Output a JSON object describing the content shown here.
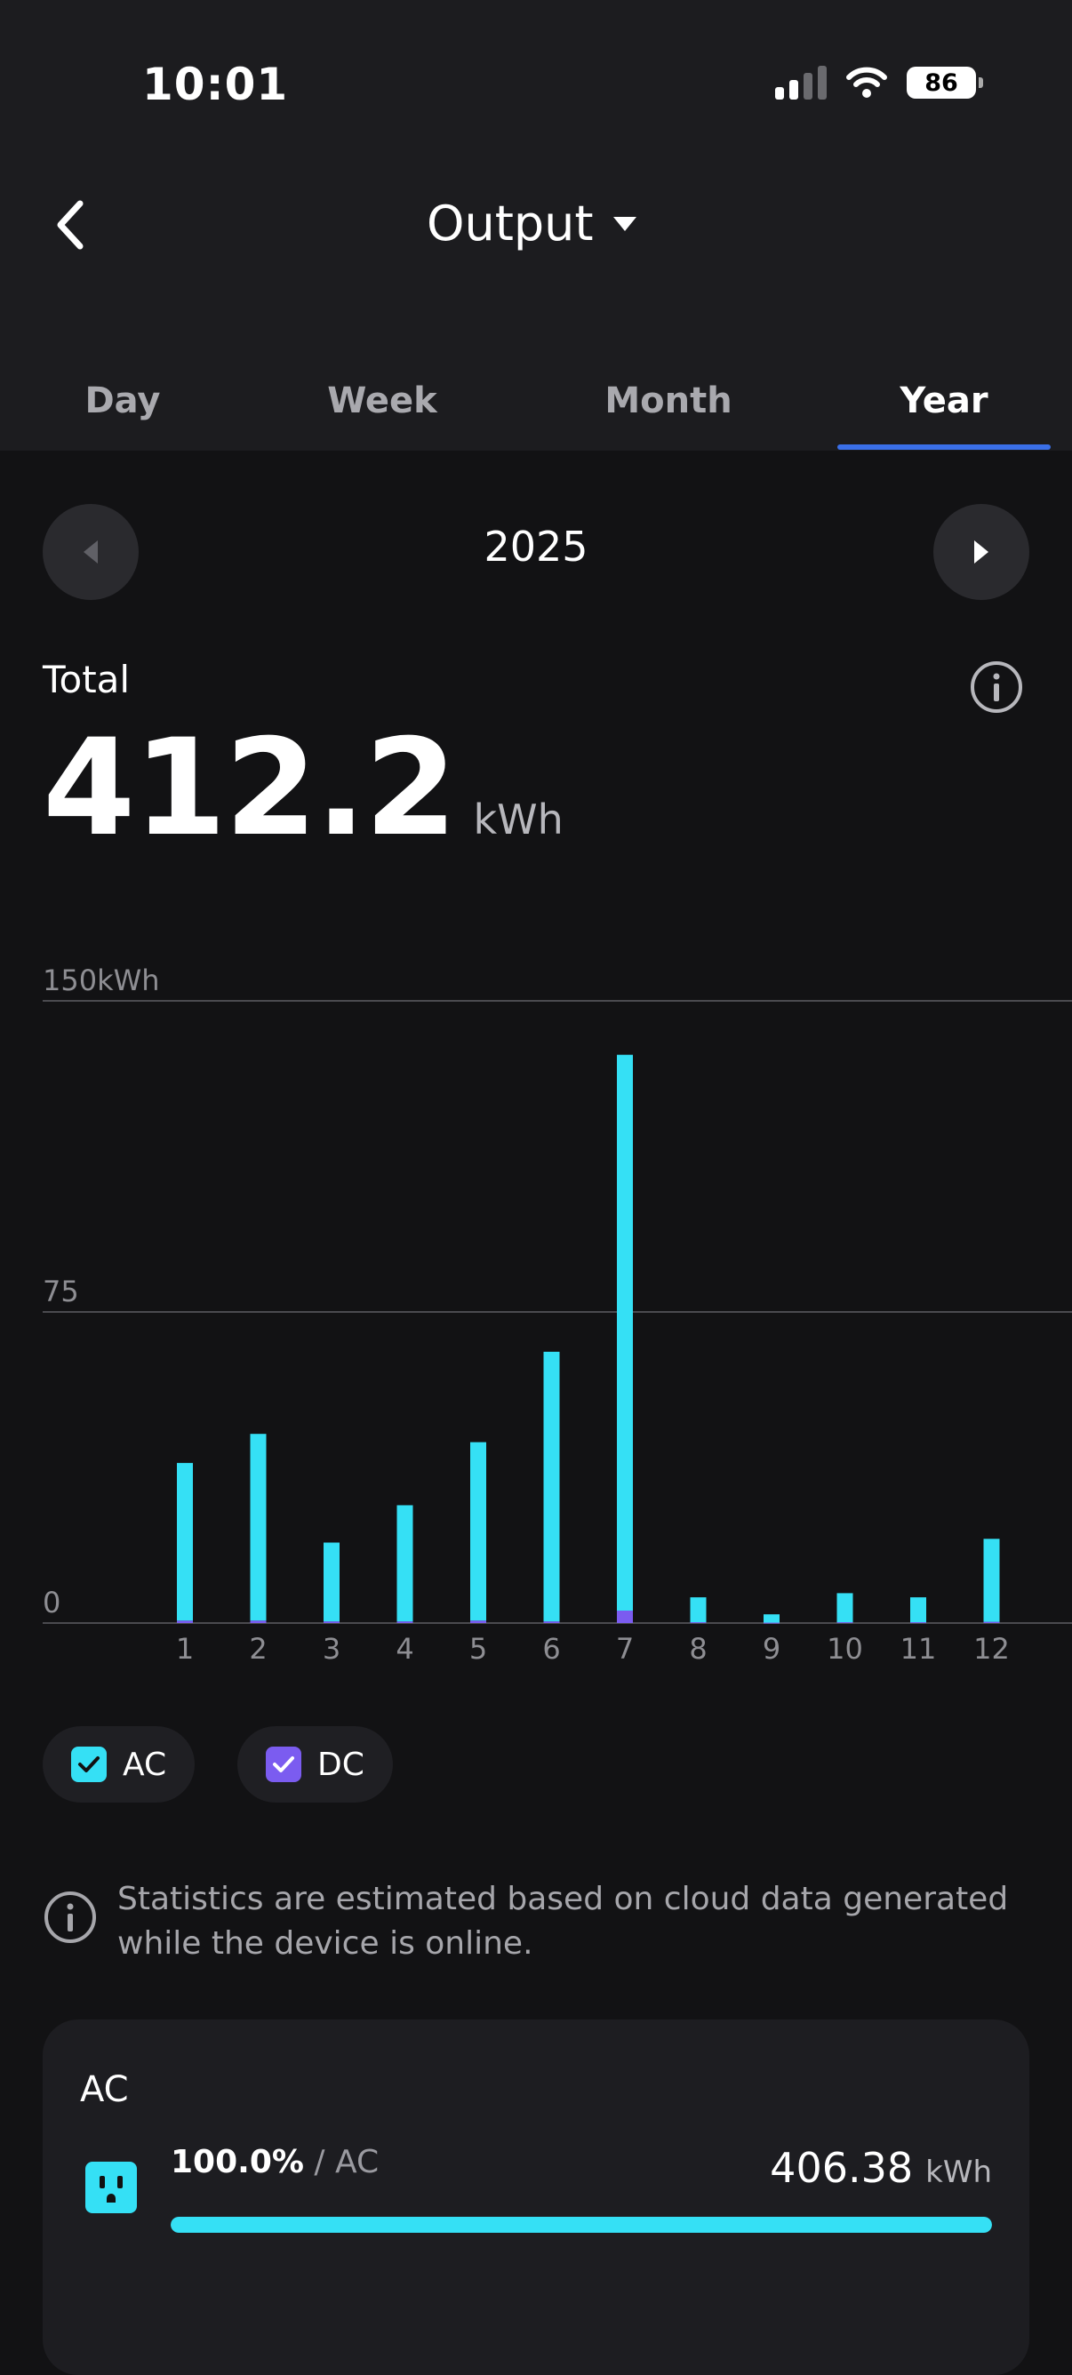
{
  "status_bar": {
    "time": "10:01",
    "battery": "86"
  },
  "header": {
    "title": "Output"
  },
  "tabs": [
    {
      "label": "Day",
      "active": false
    },
    {
      "label": "Week",
      "active": false
    },
    {
      "label": "Month",
      "active": false
    },
    {
      "label": "Year",
      "active": true
    }
  ],
  "period": {
    "label": "2025"
  },
  "total": {
    "label": "Total",
    "value": "412.2",
    "unit": "kWh"
  },
  "chart_data": {
    "type": "bar",
    "stacked": true,
    "categories": [
      "1",
      "2",
      "3",
      "4",
      "5",
      "6",
      "7",
      "8",
      "9",
      "10",
      "11",
      "12"
    ],
    "series": [
      {
        "name": "AC",
        "color": "#35e0f5",
        "values": [
          38,
          45,
          19,
          28,
          43,
          65,
          134,
          6,
          2,
          7,
          6,
          20
        ]
      },
      {
        "name": "DC",
        "color": "#7b5cf0",
        "values": [
          0.6,
          0.6,
          0.4,
          0.4,
          0.6,
          0.4,
          3,
          0.2,
          0.1,
          0.2,
          0.2,
          0.3
        ]
      }
    ],
    "yticks": [
      {
        "value": 150,
        "label": "150kWh"
      },
      {
        "value": 75,
        "label": "75"
      },
      {
        "value": 0,
        "label": "0"
      }
    ],
    "ylim": [
      0,
      150
    ],
    "grid": true
  },
  "legend": {
    "ac_label": "AC",
    "dc_label": "DC"
  },
  "note": "Statistics are estimated based on cloud data generated while the device is online.",
  "breakdown": {
    "title": "AC",
    "percent": "100.0%",
    "separator": "/",
    "category": "AC",
    "value": "406.38",
    "unit": "kWh",
    "fraction": 1.0
  }
}
